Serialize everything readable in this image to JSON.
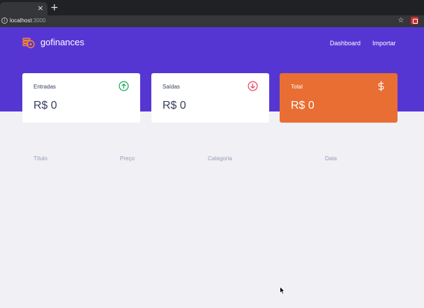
{
  "browser": {
    "tab_close": "×",
    "new_tab": "+",
    "url_host": "localhost",
    "url_port": ":3000"
  },
  "app": {
    "brand": "gofinances",
    "nav": [
      {
        "label": "Dashboard"
      },
      {
        "label": "Importar"
      }
    ]
  },
  "cards": {
    "income": {
      "title": "Entradas",
      "value": "R$ 0",
      "icon": "arrow-up-circle-icon"
    },
    "outcome": {
      "title": "Saídas",
      "value": "R$ 0",
      "icon": "arrow-down-circle-icon"
    },
    "total": {
      "title": "Total",
      "value": "R$ 0",
      "icon": "dollar-sign-icon"
    }
  },
  "table": {
    "headers": [
      "Título",
      "Preço",
      "Categoria",
      "Data"
    ]
  },
  "colors": {
    "brand": "#5636d3",
    "total_card": "#e86e33",
    "income": "#12a454",
    "outcome": "#e83f5b",
    "text": "#363f5f",
    "muted": "#969cb3",
    "background": "#f0f0f5"
  }
}
